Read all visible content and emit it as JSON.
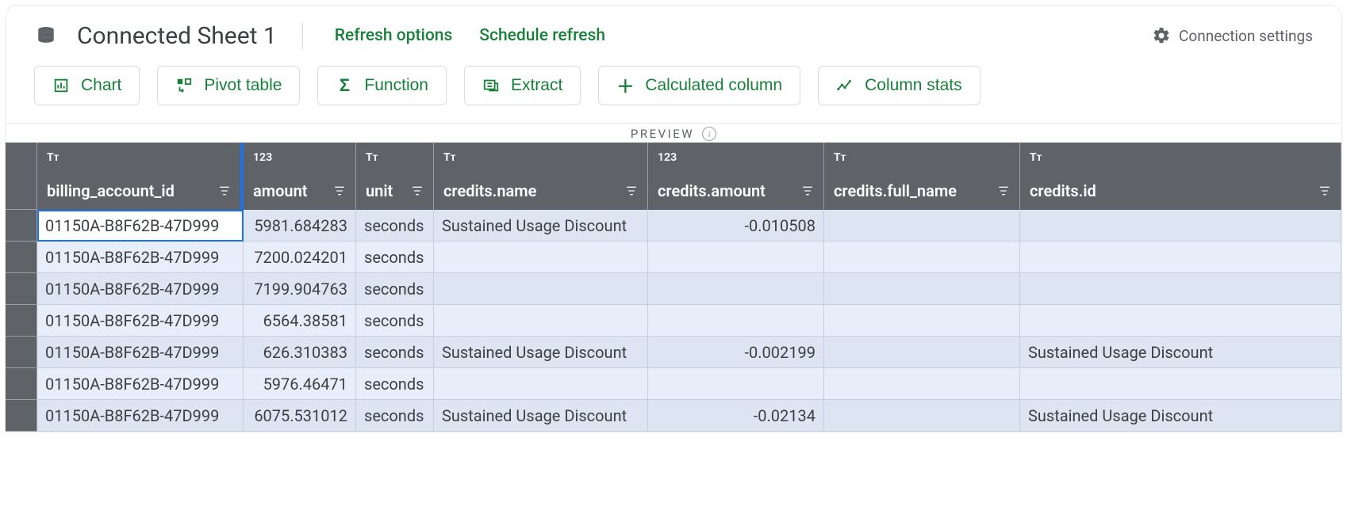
{
  "header": {
    "title": "Connected Sheet 1",
    "refresh_options": "Refresh options",
    "schedule_refresh": "Schedule refresh",
    "connection_settings": "Connection settings"
  },
  "toolbar": {
    "chart": "Chart",
    "pivot": "Pivot table",
    "function": "Function",
    "extract": "Extract",
    "calculated": "Calculated column",
    "stats": "Column stats"
  },
  "preview_label": "PREVIEW",
  "columns": [
    {
      "type": "Tᴛ",
      "name": "billing_account_id",
      "numeric": false
    },
    {
      "type": "123",
      "name": "amount",
      "numeric": true
    },
    {
      "type": "Tᴛ",
      "name": "unit",
      "numeric": false
    },
    {
      "type": "Tᴛ",
      "name": "credits.name",
      "numeric": false
    },
    {
      "type": "123",
      "name": "credits.amount",
      "numeric": true
    },
    {
      "type": "Tᴛ",
      "name": "credits.full_name",
      "numeric": false
    },
    {
      "type": "Tᴛ",
      "name": "credits.id",
      "numeric": false
    }
  ],
  "rows": [
    [
      "01150A-B8F62B-47D999",
      "5981.684283",
      "seconds",
      "Sustained Usage Discount",
      "-0.010508",
      "",
      ""
    ],
    [
      "01150A-B8F62B-47D999",
      "7200.024201",
      "seconds",
      "",
      "",
      "",
      ""
    ],
    [
      "01150A-B8F62B-47D999",
      "7199.904763",
      "seconds",
      "",
      "",
      "",
      ""
    ],
    [
      "01150A-B8F62B-47D999",
      "6564.38581",
      "seconds",
      "",
      "",
      "",
      ""
    ],
    [
      "01150A-B8F62B-47D999",
      "626.310383",
      "seconds",
      "Sustained Usage Discount",
      "-0.002199",
      "",
      "Sustained Usage Discount"
    ],
    [
      "01150A-B8F62B-47D999",
      "5976.46471",
      "seconds",
      "",
      "",
      "",
      ""
    ],
    [
      "01150A-B8F62B-47D999",
      "6075.531012",
      "seconds",
      "Sustained Usage Discount",
      "-0.02134",
      "",
      "Sustained Usage Discount"
    ]
  ],
  "selected_cell": {
    "row": 0,
    "col": 0
  }
}
